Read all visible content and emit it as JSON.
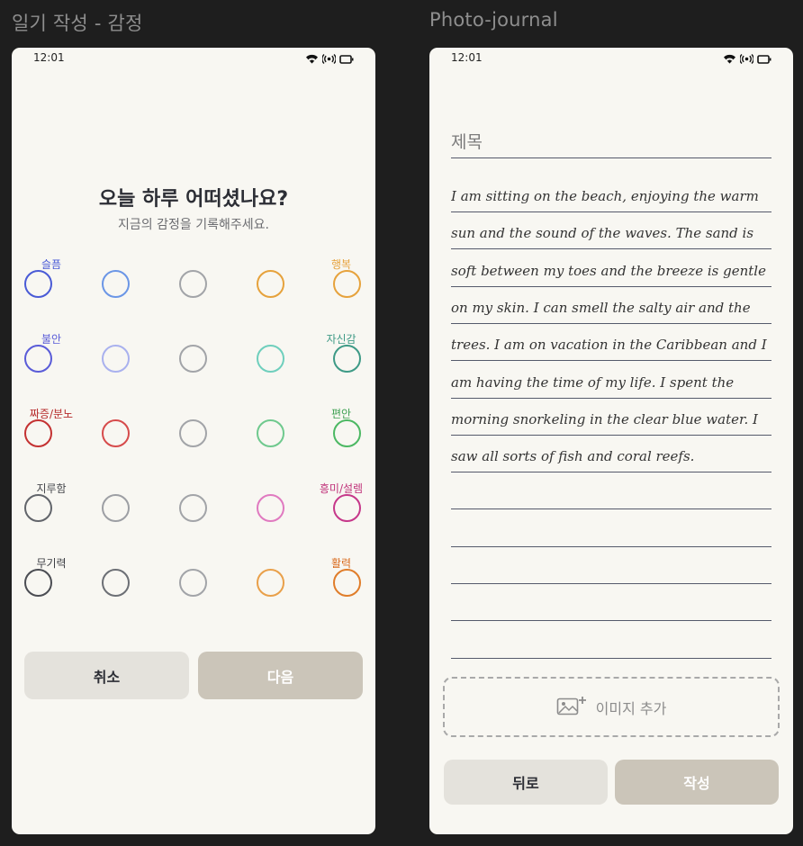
{
  "left_frame": {
    "frame_title": "일기 작성 - 감정",
    "status_time": "12:01",
    "heading": "오늘 하루 어떠셨나요?",
    "subheading": "지금의 감정을 기록해주세요.",
    "rows": [
      {
        "left_label": "슬픔",
        "right_label": "행복",
        "left_color": "#4a5bd6",
        "right_color": "#e6a23c",
        "circle_colors": [
          "#4a5bd6",
          "#6b96e6",
          "#a2a4a8",
          "#e6a23c",
          "#e6a23c"
        ]
      },
      {
        "left_label": "불안",
        "right_label": "자신감",
        "left_color": "#5a5cd8",
        "right_color": "#3e9a86",
        "circle_colors": [
          "#5a5cd8",
          "#a9b1ee",
          "#a2a4a8",
          "#6fcfbd",
          "#3e9a86"
        ]
      },
      {
        "left_label": "짜증/분노",
        "right_label": "편안",
        "left_color": "#b62a2a",
        "right_color": "#3fa153",
        "circle_colors": [
          "#c43232",
          "#d64b4b",
          "#a2a4a8",
          "#6fc98e",
          "#4cb863"
        ]
      },
      {
        "left_label": "지루함",
        "right_label": "흥미/설렘",
        "left_color": "#46484d",
        "right_color": "#c0327a",
        "circle_colors": [
          "#62656b",
          "#9d9fa4",
          "#a2a4a8",
          "#e07ac0",
          "#c6388a"
        ]
      },
      {
        "left_label": "무기력",
        "right_label": "활력",
        "left_color": "#3b3d42",
        "right_color": "#d9691b",
        "circle_colors": [
          "#4b4d53",
          "#6c6f75",
          "#a2a4a8",
          "#e9a04a",
          "#e07d2a"
        ]
      }
    ],
    "cancel_label": "취소",
    "next_label": "다음"
  },
  "right_frame": {
    "frame_title": "Photo-journal",
    "status_time": "12:01",
    "title_placeholder": "제목",
    "body_lines": [
      "I am sitting on the beach, enjoying the warm",
      "sun and the sound of the waves. The sand is",
      "soft between my toes and the breeze is gentle",
      "on my skin. I can smell the salty air and the",
      "trees. I am on vacation in the Caribbean and I",
      "am having the time of my life. I spent the",
      "morning snorkeling in the clear blue water. I",
      "saw all sorts of fish and coral reefs.",
      "",
      "",
      "",
      "",
      ""
    ],
    "add_image_label": "이미지 추가",
    "back_label": "뒤로",
    "write_label": "작성"
  },
  "colors": {
    "background": "#1e1e1e",
    "surface": "#f8f7f2",
    "secondary_button": "#e4e2dc",
    "primary_button": "#cbc5b9",
    "primary_button_text": "#ffffff"
  },
  "icons": {
    "status": [
      "wifi-icon",
      "signal-icon",
      "battery-icon"
    ],
    "image_add": "image-add-icon"
  }
}
